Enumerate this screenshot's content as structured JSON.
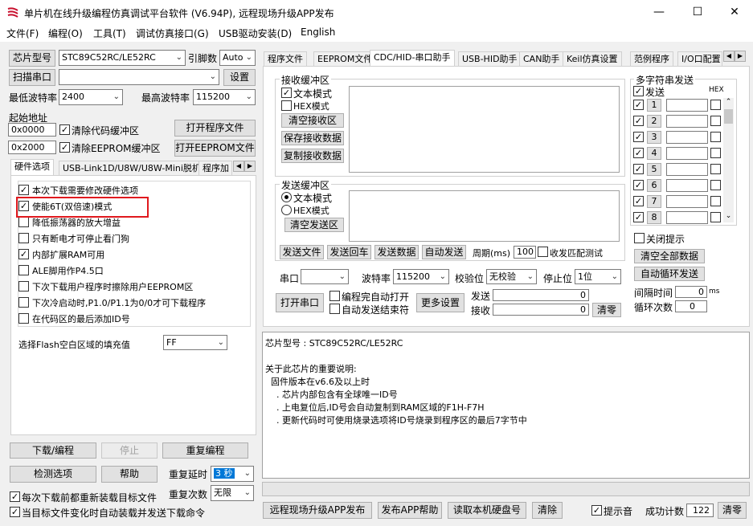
{
  "title": "单片机在线升级编程仿真调试平台软件 (V6.94P), 远程现场升级APP发布",
  "menu": [
    "文件(F)",
    "编程(O)",
    "工具(T)",
    "调试仿真接口(G)",
    "USB驱动安装(D)",
    "English"
  ],
  "left": {
    "chip_type_btn": "芯片型号",
    "chip_type_value": "STC89C52RC/LE52RC",
    "pins_label": "引脚数",
    "pins_value": "Auto",
    "scan_btn": "扫描串口",
    "settings_btn": "设置",
    "min_baud_label": "最低波特率",
    "min_baud_value": "2400",
    "max_baud_label": "最高波特率",
    "max_baud_value": "115200",
    "start_addr_label": "起始地址",
    "addr1": "0x0000",
    "clear_code_label": "清除代码缓冲区",
    "open_program_btn": "打开程序文件",
    "addr2": "0x2000",
    "clear_eeprom_label": "清除EEPROM缓冲区",
    "open_eeprom_btn": "打开EEPROM文件",
    "tabs": [
      "硬件选项",
      "USB-Link1D/U8W/U8W-Mini脱机",
      "程序加"
    ],
    "hw_options": [
      {
        "label": "本次下载需要修改硬件选项",
        "checked": true
      },
      {
        "label": "使能6T(双倍速)模式",
        "checked": true
      },
      {
        "label": "降低振荡器的放大增益",
        "checked": false
      },
      {
        "label": "只有断电才可停止看门狗",
        "checked": false
      },
      {
        "label": "内部扩展RAM可用",
        "checked": true
      },
      {
        "label": "ALE脚用作P4.5口",
        "checked": false
      },
      {
        "label": "下次下载用户程序时擦除用户EEPROM区",
        "checked": false
      },
      {
        "label": "下次冷启动时,P1.0/P1.1为0/0才可下载程序",
        "checked": false
      },
      {
        "label": "在代码区的最后添加ID号",
        "checked": false
      }
    ],
    "flash_fill_label": "选择Flash空白区域的填充值",
    "flash_fill_value": "FF",
    "download_btn": "下载/编程",
    "stop_btn": "停止",
    "reprogram_btn": "重复编程",
    "check_btn": "检测选项",
    "help_btn": "帮助",
    "repeat_delay_label": "重复延时",
    "repeat_delay_value": "3 秒",
    "repeat_count_label": "重复次数",
    "repeat_count_value": "无限",
    "reload_label": "每次下载前都重新装载目标文件",
    "auto_send_label": "当目标文件变化时自动装载并发送下载命令"
  },
  "right": {
    "tabs": [
      "程序文件",
      "EEPROM文件",
      "CDC/HID-串口助手",
      "USB-HID助手",
      "CAN助手",
      "Keil仿真设置",
      "范例程序",
      "I/O口配置"
    ],
    "recv_group": "接收缓冲区",
    "text_mode": "文本模式",
    "hex_mode": "HEX模式",
    "clear_recv_btn": "清空接收区",
    "save_recv_btn": "保存接收数据",
    "copy_recv_btn": "复制接收数据",
    "send_group": "发送缓冲区",
    "clear_send_btn": "清空发送区",
    "send_file_btn": "发送文件",
    "send_return_btn": "发送回车",
    "send_data_btn": "发送数据",
    "auto_send_btn": "自动发送",
    "period_label": "周期(ms)",
    "period_value": "100",
    "match_test_label": "收发匹配测试",
    "port_label": "串口",
    "baud_label": "波特率",
    "baud_value": "115200",
    "parity_label": "校验位",
    "parity_value": "无校验",
    "stopbit_label": "停止位",
    "stopbit_value": "1位",
    "open_port_btn": "打开串口",
    "auto_open_label": "编程完自动打开",
    "auto_end_label": "自动发送结束符",
    "more_settings_btn": "更多设置",
    "send_count_label": "发送",
    "send_count": "0",
    "recv_count_label": "接收",
    "recv_count": "0",
    "clear_count_btn": "清零",
    "multi_group": "多字符串发送",
    "multi_send_label": "发送",
    "hex_label": "HEX",
    "multi_rows": [
      "1",
      "2",
      "3",
      "4",
      "5",
      "6",
      "7",
      "8"
    ],
    "close_tip_label": "关闭提示",
    "clear_all_btn": "清空全部数据",
    "auto_loop_btn": "自动循环发送",
    "interval_label": "间隔时间",
    "interval_value": "0",
    "interval_unit": "ms",
    "loop_count_label": "循环次数",
    "loop_count_value": "0"
  },
  "info": {
    "lines": [
      "芯片型号 : STC89C52RC/LE52RC",
      "",
      "关于此芯片的重要说明:",
      "  固件版本在v6.6及以上时",
      "    . 芯片内部包含有全球唯一ID号",
      "    . 上电复位后,ID号会自动复制到RAM区域的F1H-F7H",
      "    . 更新代码时可使用烧录选项将ID号烧录到程序区的最后7字节中"
    ]
  },
  "bottom": {
    "remote_btn": "远程现场升级APP发布",
    "publish_help_btn": "发布APP帮助",
    "read_disk_btn": "读取本机硬盘号",
    "clear_btn": "清除",
    "tip_sound_label": "提示音",
    "success_label": "成功计数",
    "success_value": "122",
    "reset_btn": "清零"
  }
}
